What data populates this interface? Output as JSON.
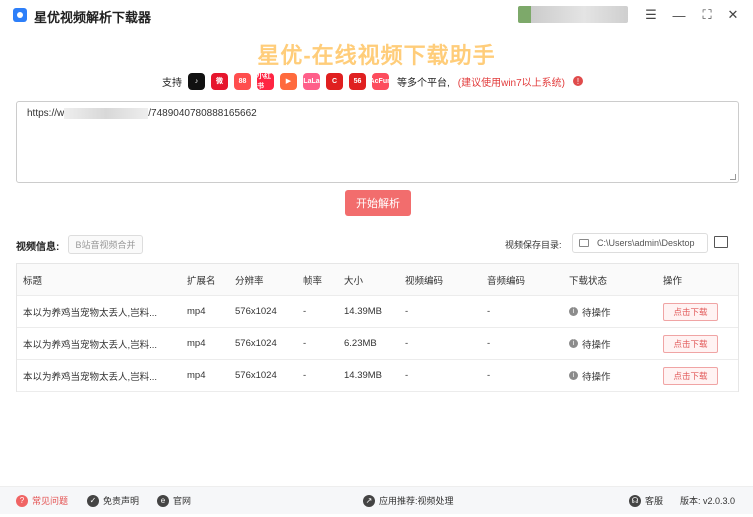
{
  "app": {
    "title": "星优视频解析下载器"
  },
  "window": {
    "settings_glyph": "☰",
    "min_glyph": "—",
    "max_glyph": "⛶",
    "close_glyph": "✕"
  },
  "hero": {
    "title": "星优-在线视频下载助手"
  },
  "support": {
    "prefix": "支持",
    "platforms": [
      {
        "name": "tiktok-icon",
        "text": "♪",
        "color": "#111111"
      },
      {
        "name": "weibo-icon",
        "text": "微",
        "color": "#e6162d"
      },
      {
        "name": "xiaohongshu-icon",
        "text": "88",
        "color": "#ff4e4e"
      },
      {
        "name": "xiaohongshu-text-icon",
        "text": "小红书",
        "color": "#ff2442"
      },
      {
        "name": "play-icon",
        "text": "▶",
        "color": "#ff6a3d"
      },
      {
        "name": "lala-icon",
        "text": "LaLa",
        "color": "#ff5f8a"
      },
      {
        "name": "c-logo-icon",
        "text": "C",
        "color": "#e02020"
      },
      {
        "name": "56-icon",
        "text": "56",
        "color": "#e02020"
      },
      {
        "name": "acfun-icon",
        "text": "AcFun",
        "color": "#fd4c5d"
      }
    ],
    "more": "等多个平台,",
    "note": "(建议使用win7以上系统)"
  },
  "url_input": {
    "prefix": "https://w",
    "suffix": "/7489040780888165662"
  },
  "parse_button": "开始解析",
  "video_info": {
    "label": "视频信息:",
    "merge_button": "B站音视频合并"
  },
  "save_dir": {
    "label": "视频保存目录:",
    "path": "C:\\Users\\admin\\Desktop"
  },
  "table": {
    "headers": [
      "标题",
      "扩展名",
      "分辨率",
      "帧率",
      "大小",
      "视频编码",
      "音频编码",
      "下载状态",
      "操作"
    ],
    "rows": [
      {
        "title": "本以为养鸡当宠物太丢人,岂料...",
        "ext": "mp4",
        "res": "576x1024",
        "fps": "-",
        "size": "14.39MB",
        "vcodec": "-",
        "acodec": "-",
        "status": "待操作",
        "action": "点击下载"
      },
      {
        "title": "本以为养鸡当宠物太丢人,岂料...",
        "ext": "mp4",
        "res": "576x1024",
        "fps": "-",
        "size": "6.23MB",
        "vcodec": "-",
        "acodec": "-",
        "status": "待操作",
        "action": "点击下载"
      },
      {
        "title": "本以为养鸡当宠物太丢人,岂料...",
        "ext": "mp4",
        "res": "576x1024",
        "fps": "-",
        "size": "14.39MB",
        "vcodec": "-",
        "acodec": "-",
        "status": "待操作",
        "action": "点击下载"
      }
    ]
  },
  "footer": {
    "faq": "常见问题",
    "disclaimer": "免责声明",
    "website": "官网",
    "recommend": "应用推荐:视频处理",
    "support": "客服",
    "version": "版本: v2.0.3.0"
  }
}
